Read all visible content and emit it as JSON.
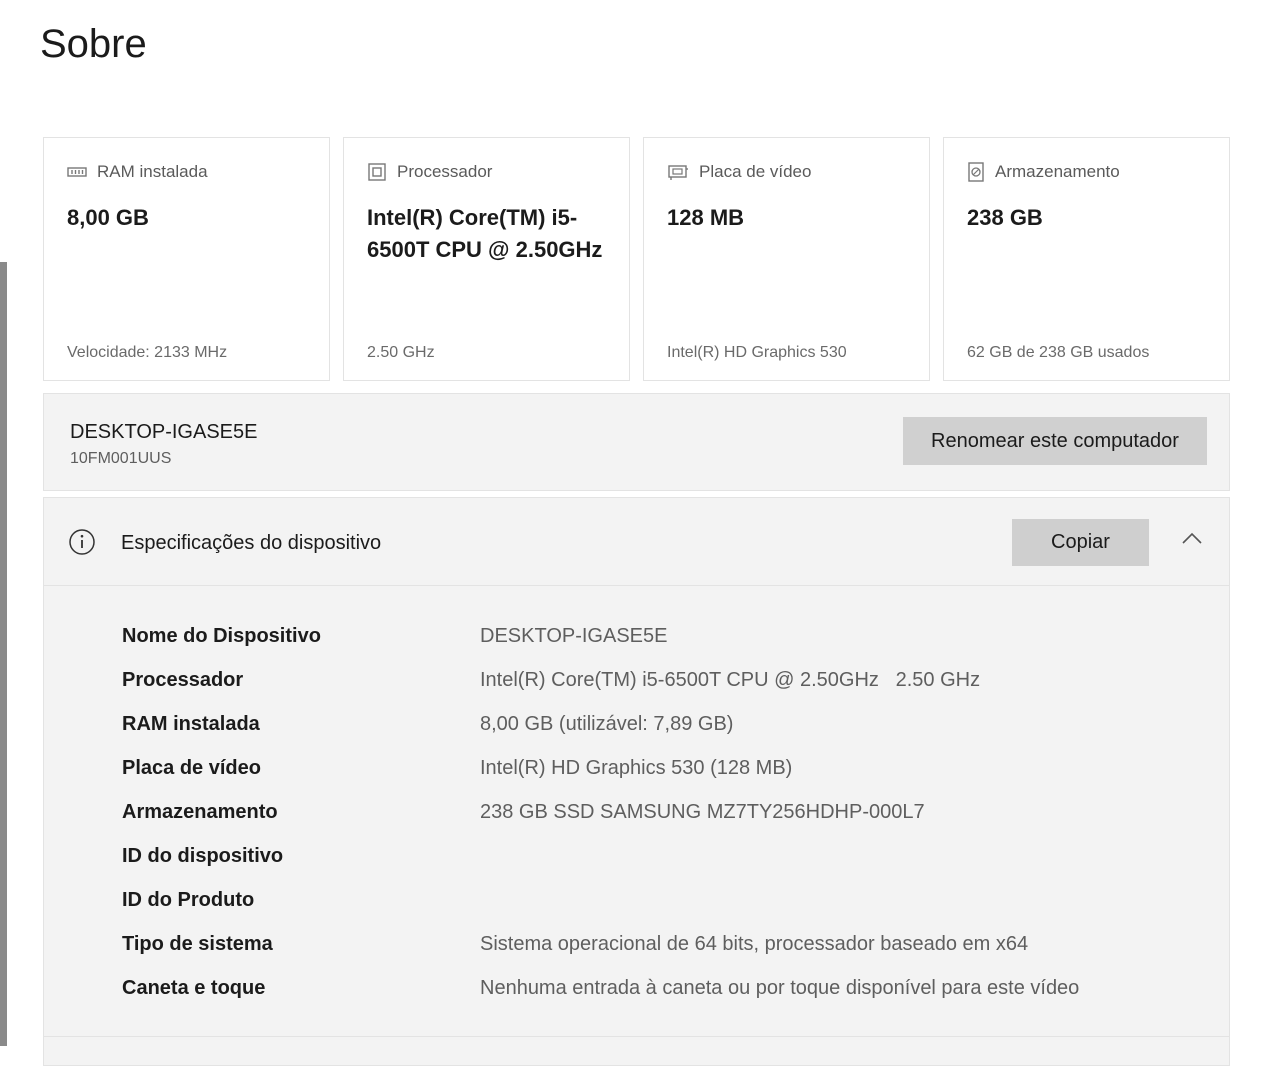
{
  "page": {
    "title": "Sobre"
  },
  "cards": [
    {
      "icon": "ram-icon",
      "label": "RAM instalada",
      "value": "8,00 GB",
      "footer": "Velocidade: 2133 MHz"
    },
    {
      "icon": "processor-icon",
      "label": "Processador",
      "value": "Intel(R) Core(TM) i5-6500T CPU @ 2.50GHz",
      "footer": "2.50 GHz"
    },
    {
      "icon": "video-card-icon",
      "label": "Placa de vídeo",
      "value": "128 MB",
      "footer": "Intel(R) HD Graphics 530"
    },
    {
      "icon": "storage-icon",
      "label": "Armazenamento",
      "value": "238 GB",
      "footer": "62 GB de 238 GB usados"
    }
  ],
  "device": {
    "name": "DESKTOP-IGASE5E",
    "model": "10FM001UUS",
    "rename_label": "Renomear este computador"
  },
  "specs": {
    "title": "Especificações do dispositivo",
    "copy_label": "Copiar",
    "rows": [
      {
        "label": "Nome do Dispositivo",
        "value": "DESKTOP-IGASE5E"
      },
      {
        "label": "Processador",
        "value": "Intel(R) Core(TM) i5-6500T CPU @ 2.50GHz   2.50 GHz"
      },
      {
        "label": "RAM instalada",
        "value": "8,00 GB (utilizável: 7,89 GB)"
      },
      {
        "label": "Placa de vídeo",
        "value": "Intel(R) HD Graphics 530 (128 MB)"
      },
      {
        "label": "Armazenamento",
        "value": "238 GB SSD SAMSUNG MZ7TY256HDHP-000L7"
      },
      {
        "label": "ID do dispositivo",
        "value": ""
      },
      {
        "label": "ID do Produto",
        "value": ""
      },
      {
        "label": "Tipo de sistema",
        "value": "Sistema operacional de 64 bits, processador baseado em x64"
      },
      {
        "label": "Caneta e toque",
        "value": "Nenhuma entrada à caneta ou por toque disponível para este vídeo"
      }
    ]
  }
}
